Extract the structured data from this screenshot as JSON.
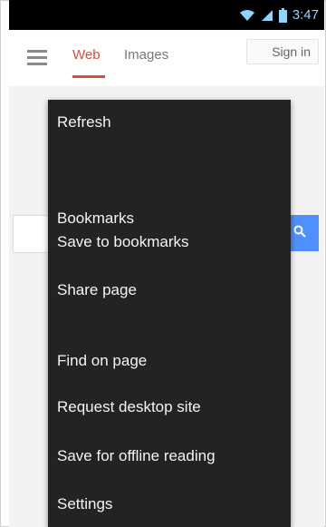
{
  "status_bar": {
    "time": "3:47",
    "icons": [
      "wifi-icon",
      "signal-icon",
      "battery-icon"
    ]
  },
  "browser": {
    "tabs": [
      {
        "label": "Web",
        "active": true
      },
      {
        "label": "Images",
        "active": false
      }
    ],
    "sign_in_label": "Sign in",
    "search_icon": "search-icon",
    "accent_color": "#dd4b39",
    "search_button_color": "#4d90fe"
  },
  "menu": {
    "items": [
      {
        "label": "Refresh"
      },
      {
        "label": "Bookmarks"
      },
      {
        "label": "Save to bookmarks"
      },
      {
        "label": "Share page"
      },
      {
        "label": "Find on page"
      },
      {
        "label": "Request desktop site"
      },
      {
        "label": "Save for offline reading"
      },
      {
        "label": "Settings"
      }
    ]
  }
}
